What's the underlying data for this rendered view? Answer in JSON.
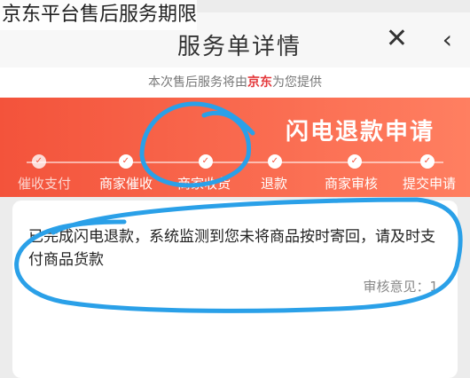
{
  "caption": "京东平台售后服务期限",
  "navbar": {
    "title": "服务单详情",
    "back_icon": "chevron-left-icon",
    "close_icon": "close-icon"
  },
  "notice": {
    "prefix": "本次售后服务将由",
    "brand": "京东",
    "suffix": "为您提供"
  },
  "banner": {
    "title": "闪电退款申请",
    "steps": [
      {
        "label": "提交申请",
        "active": true
      },
      {
        "label": "商家审核",
        "active": true
      },
      {
        "label": "退款",
        "active": true
      },
      {
        "label": "商家收货",
        "active": true
      },
      {
        "label": "商家催收",
        "active": true
      },
      {
        "label": "催收支付",
        "active": false
      }
    ]
  },
  "card": {
    "message": "已完成闪电退款，系统监测到您未将商品按时寄回，请及时支付商品货款",
    "audit": "审核意见：1"
  },
  "colors": {
    "accent": "#f3533b",
    "brand": "#e4393c",
    "scribble": "#2aa0e8"
  }
}
